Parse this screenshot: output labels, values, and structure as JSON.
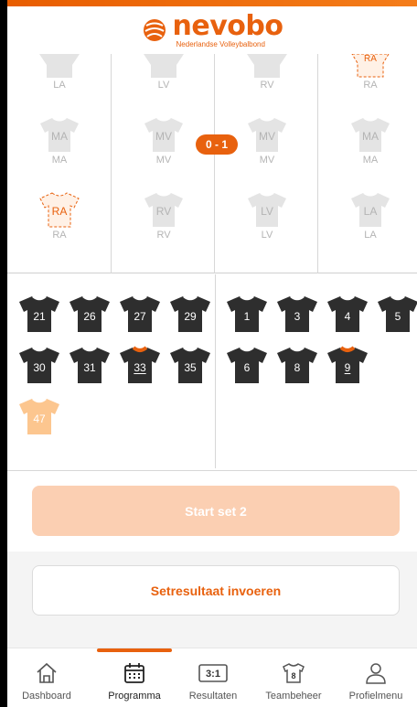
{
  "brand": {
    "name": "nevobo",
    "subtitle": "Nederlandse Volleybalbond",
    "accent": "#e8610e",
    "accent_light": "#fbcfb2"
  },
  "court": {
    "score": "0 - 1",
    "left_team": {
      "row_top": [
        {
          "shirt": "LA",
          "label": "LA"
        },
        {
          "shirt": "LV",
          "label": "LV"
        }
      ],
      "row_mid": [
        {
          "shirt": "MA",
          "label": "MA"
        },
        {
          "shirt": "MV",
          "label": "MV"
        }
      ],
      "row_bot": [
        {
          "shirt": "RA",
          "label": "RA",
          "highlight": true
        },
        {
          "shirt": "RV",
          "label": "RV"
        }
      ]
    },
    "right_team": {
      "row_top": [
        {
          "shirt": "RV",
          "label": "RV"
        },
        {
          "shirt": "RA",
          "label": "RA",
          "highlight": true
        }
      ],
      "row_mid": [
        {
          "shirt": "MV",
          "label": "MV"
        },
        {
          "shirt": "MA",
          "label": "MA"
        }
      ],
      "row_bot": [
        {
          "shirt": "LV",
          "label": "LV"
        },
        {
          "shirt": "LA",
          "label": "LA"
        }
      ]
    }
  },
  "bench": {
    "left": [
      "21",
      "26",
      "27",
      "29",
      "30",
      "31",
      "33",
      "35",
      "47"
    ],
    "right": [
      "1",
      "3",
      "4",
      "5",
      "6",
      "8",
      "9"
    ],
    "captains": [
      "33",
      "9"
    ],
    "libero": "47"
  },
  "actions": {
    "start_set": "Start set 2",
    "set_result": "Setresultaat invoeren"
  },
  "nav": {
    "items": [
      {
        "label": "Dashboard",
        "icon": "home-icon"
      },
      {
        "label": "Programma",
        "icon": "calendar-icon"
      },
      {
        "label": "Resultaten",
        "icon": "score-icon",
        "icon_text": "3:1"
      },
      {
        "label": "Teambeheer",
        "icon": "shirt-icon",
        "icon_text": "8"
      },
      {
        "label": "Profielmenu",
        "icon": "person-icon"
      }
    ],
    "active": "Programma"
  }
}
